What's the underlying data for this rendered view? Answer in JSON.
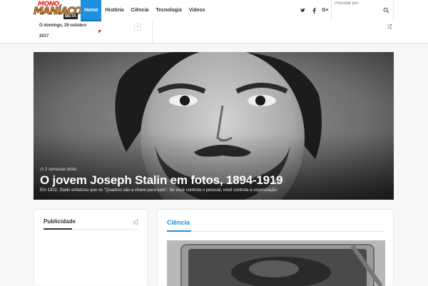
{
  "logo": {
    "line1": "MONO",
    "line2": "MANÍACOS",
    "badge": "BETA"
  },
  "nav": [
    {
      "label": "Home",
      "active": true
    },
    {
      "label": "História"
    },
    {
      "label": "Ciência"
    },
    {
      "label": "Tecnologia"
    },
    {
      "label": "Videos"
    }
  ],
  "social": {
    "twitter": "twitter-icon",
    "facebook": "facebook-icon",
    "googleplus": "google-plus-icon"
  },
  "search": {
    "placeholder": "Procurar por"
  },
  "dateline": {
    "day": "O domingo, 29 outubro",
    "year": "2017"
  },
  "colors": {
    "accent": "#1e90e0",
    "logo_red": "#e2231a",
    "logo_orange": "#f28a1e"
  },
  "hero": {
    "meta": "2 semanas atrás",
    "title": "O jovem Joseph Stalin em fotos, 1894-1919",
    "excerpt": "Em 1922, Stalin enfatizou que os \"Quadros são a chave para tudo\". Se você controla o pessoal, você controla a organização."
  },
  "widgets": {
    "ads": {
      "title": "Publicidade"
    },
    "science": {
      "title": "Ciência"
    }
  }
}
